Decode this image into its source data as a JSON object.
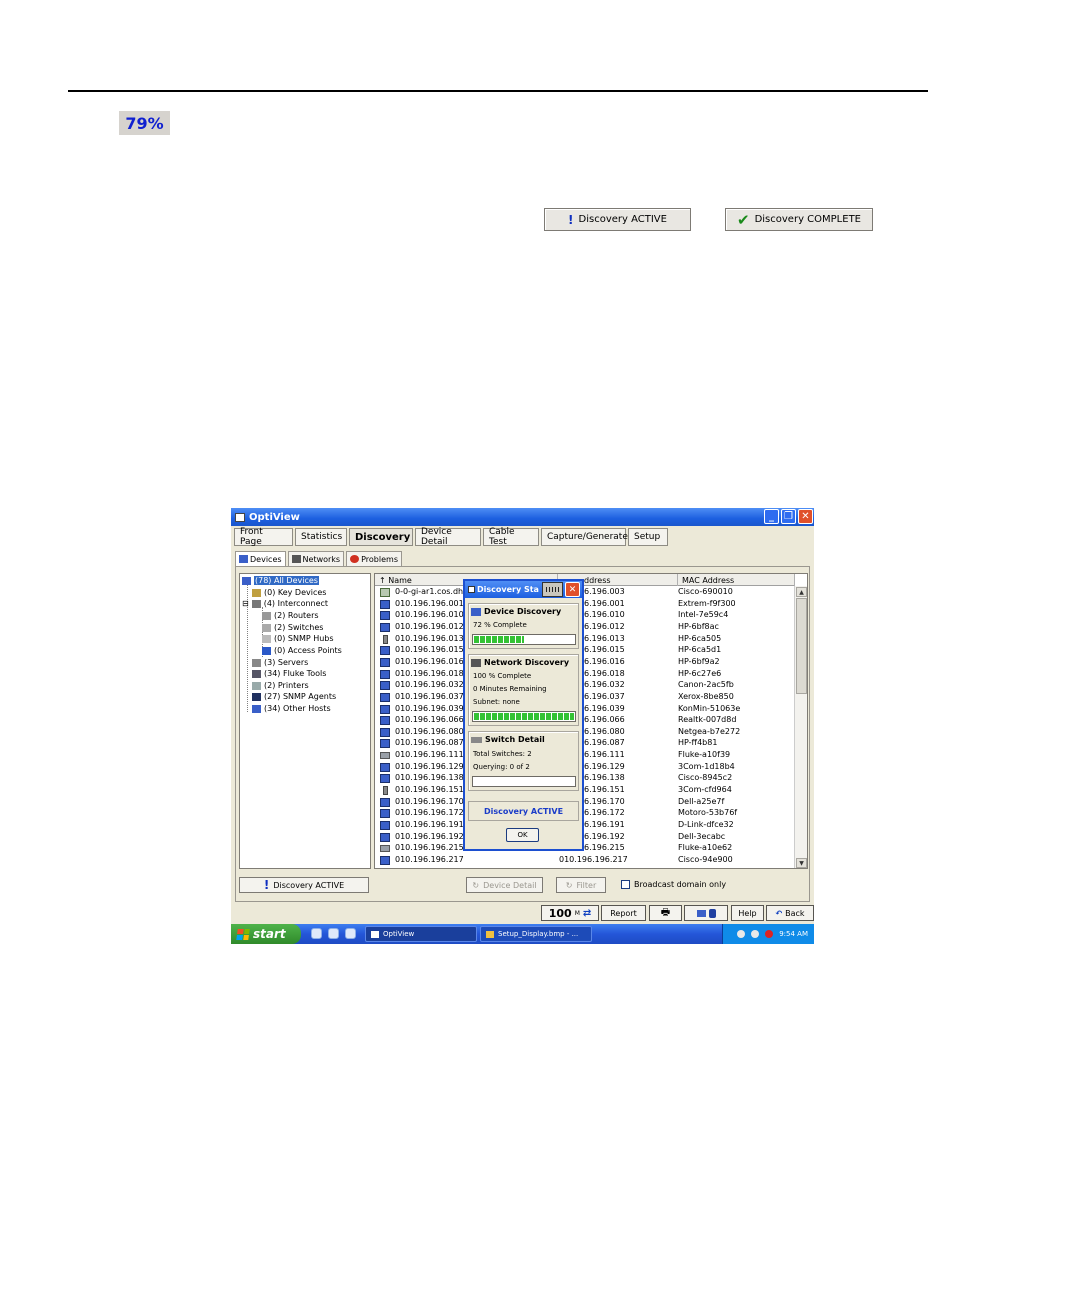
{
  "doc": {
    "progress_percent_label": "79%",
    "sample_active_label": "Discovery ACTIVE",
    "sample_complete_label": "Discovery COMPLETE"
  },
  "window": {
    "title": "OptiView",
    "tabs": [
      "Front Page",
      "Statistics",
      "Discovery",
      "Device Detail",
      "Cable Test",
      "Capture/Generate",
      "Setup"
    ],
    "active_tab": "Discovery",
    "subtabs": [
      "Devices",
      "Networks",
      "Problems"
    ]
  },
  "tree": [
    {
      "label": "(78)  All Devices",
      "selected": true
    },
    {
      "label": "(0)  Key Devices"
    },
    {
      "label": "(4)  Interconnect"
    },
    {
      "label": "(2)  Routers"
    },
    {
      "label": "(2)  Switches"
    },
    {
      "label": "(0)  SNMP Hubs"
    },
    {
      "label": "(0)  Access Points"
    },
    {
      "label": "(3)  Servers"
    },
    {
      "label": "(34)  Fluke Tools"
    },
    {
      "label": "(2)  Printers"
    },
    {
      "label": "(27)  SNMP Agents"
    },
    {
      "label": "(34)  Other Hosts"
    }
  ],
  "list": {
    "columns": [
      "Name",
      "ddress",
      "MAC Address"
    ],
    "rows": [
      {
        "name": "0-0-gi-ar1.cos.dhrt",
        "ip": "6.196.003",
        "mac": "Cisco-690010",
        "icon": "key"
      },
      {
        "name": "010.196.196.001",
        "ip": "6.196.001",
        "mac": "Extrem-f9f300",
        "icon": "host"
      },
      {
        "name": "010.196.196.010",
        "ip": "6.196.010",
        "mac": "Intel-7e59c4",
        "icon": "host"
      },
      {
        "name": "010.196.196.012",
        "ip": "6.196.012",
        "mac": "HP-6bf8ac",
        "icon": "host"
      },
      {
        "name": "010.196.196.013",
        "ip": "6.196.013",
        "mac": "HP-6ca505",
        "icon": "server"
      },
      {
        "name": "010.196.196.015",
        "ip": "6.196.015",
        "mac": "HP-6ca5d1",
        "icon": "host"
      },
      {
        "name": "010.196.196.016",
        "ip": "6.196.016",
        "mac": "HP-6bf9a2",
        "icon": "host"
      },
      {
        "name": "010.196.196.018",
        "ip": "6.196.018",
        "mac": "HP-6c27e6",
        "icon": "host"
      },
      {
        "name": "010.196.196.032",
        "ip": "6.196.032",
        "mac": "Canon-2ac5fb",
        "icon": "host"
      },
      {
        "name": "010.196.196.037",
        "ip": "6.196.037",
        "mac": "Xerox-8be850",
        "icon": "host"
      },
      {
        "name": "010.196.196.039",
        "ip": "6.196.039",
        "mac": "KonMin-51063e",
        "icon": "host"
      },
      {
        "name": "010.196.196.066",
        "ip": "6.196.066",
        "mac": "Realtk-007d8d",
        "icon": "host"
      },
      {
        "name": "010.196.196.080",
        "ip": "6.196.080",
        "mac": "Netgea-b7e272",
        "icon": "host"
      },
      {
        "name": "010.196.196.087",
        "ip": "6.196.087",
        "mac": "HP-ff4b81",
        "icon": "host"
      },
      {
        "name": "010.196.196.111",
        "ip": "6.196.111",
        "mac": "Fluke-a10f39",
        "icon": "printer"
      },
      {
        "name": "010.196.196.129",
        "ip": "6.196.129",
        "mac": "3Com-1d18b4",
        "icon": "host"
      },
      {
        "name": "010.196.196.138",
        "ip": "6.196.138",
        "mac": "Cisco-8945c2",
        "icon": "host"
      },
      {
        "name": "010.196.196.151",
        "ip": "6.196.151",
        "mac": "3Com-cfd964",
        "icon": "server"
      },
      {
        "name": "010.196.196.170",
        "ip": "6.196.170",
        "mac": "Dell-a25e7f",
        "icon": "host"
      },
      {
        "name": "010.196.196.172",
        "ip": "6.196.172",
        "mac": "Motoro-53b76f",
        "icon": "host"
      },
      {
        "name": "010.196.196.191",
        "ip": "6.196.191",
        "mac": "D-Link-dfce32",
        "icon": "host"
      },
      {
        "name": "010.196.196.192",
        "ip": "6.196.192",
        "mac": "Dell-3ecabc",
        "icon": "host"
      },
      {
        "name": "010.196.196.215",
        "ip": "6.196.215",
        "mac": "Fluke-a10e62",
        "icon": "printer"
      },
      {
        "name": "010.196.196.217",
        "ip": "010.196.196.217",
        "mac": "Cisco-94e900",
        "icon": "host"
      }
    ]
  },
  "dialog": {
    "title": "Discovery Sta",
    "device_heading": "Device Discovery",
    "device_pct": "72 % Complete",
    "device_progress": 0.72,
    "network_heading": "Network Discovery",
    "network_pct": "100 % Complete",
    "network_remaining": "0 Minutes Remaining",
    "network_subnet": "Subnet: none",
    "network_progress": 1.0,
    "switch_heading": "Switch Detail",
    "switch_total": "Total Switches: 2",
    "switch_querying": "Querying: 0 of 2",
    "switch_progress": 0.0,
    "status": "Discovery ACTIVE",
    "ok_label": "OK"
  },
  "controls": {
    "discovery_active": "Discovery ACTIVE",
    "device_detail": "Device Detail",
    "filter": "Filter",
    "broadcast_label": "Broadcast domain only"
  },
  "toolbar": {
    "speed": "100",
    "speed_unit": "M",
    "report": "Report",
    "help": "Help",
    "back": "Back"
  },
  "taskbar": {
    "start": "start",
    "item1": "OptiView",
    "item2": "Setup_Display.bmp - ...",
    "clock": "9:54 AM"
  }
}
